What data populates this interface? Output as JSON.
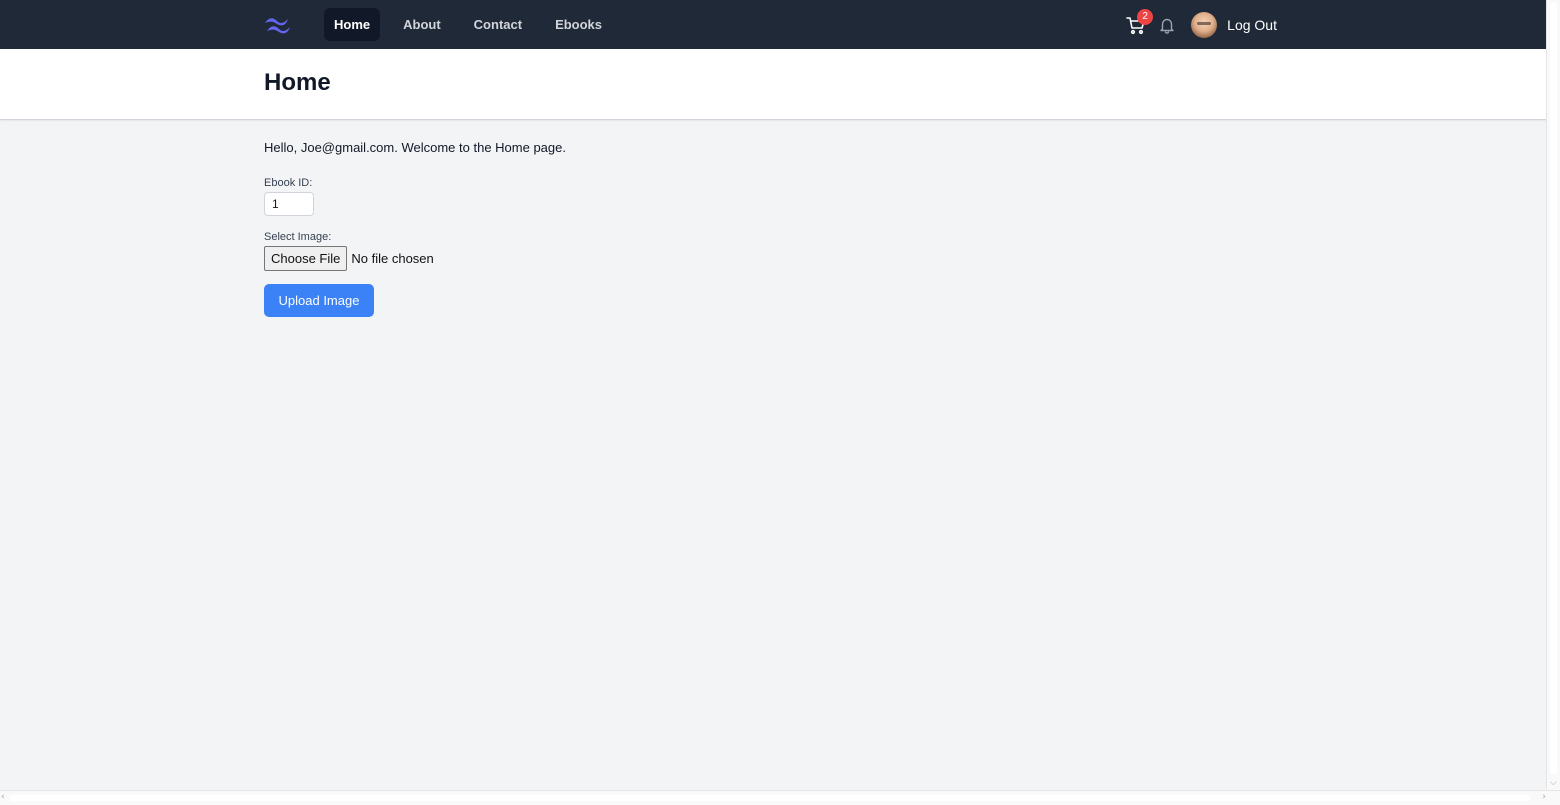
{
  "nav": {
    "logo_icon": "tailwind-wave-logo",
    "links": [
      {
        "label": "Home",
        "active": true
      },
      {
        "label": "About",
        "active": false
      },
      {
        "label": "Contact",
        "active": false
      },
      {
        "label": "Ebooks",
        "active": false
      }
    ],
    "cart_icon": "cart-icon",
    "cart_count": "2",
    "bell_icon": "bell-icon",
    "logout_label": "Log Out"
  },
  "header": {
    "title": "Home"
  },
  "main": {
    "welcome_text": "Hello, Joe@gmail.com. Welcome to the Home page.",
    "ebook_id_label": "Ebook ID:",
    "ebook_id_value": "1",
    "select_image_label": "Select Image:",
    "choose_file_label": "Choose File",
    "file_status": "No file chosen",
    "upload_label": "Upload Image"
  },
  "colors": {
    "navbar_bg": "#1f2937",
    "active_link_bg": "#111827",
    "badge": "#ef4444",
    "primary_button": "#3b82f6",
    "page_bg": "#f3f4f6"
  }
}
